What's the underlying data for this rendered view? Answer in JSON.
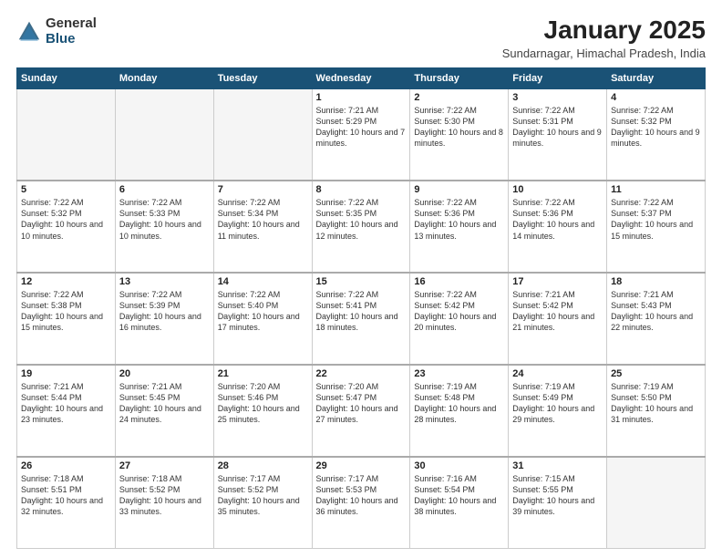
{
  "logo": {
    "general": "General",
    "blue": "Blue"
  },
  "header": {
    "month": "January 2025",
    "location": "Sundarnagar, Himachal Pradesh, India"
  },
  "weekdays": [
    "Sunday",
    "Monday",
    "Tuesday",
    "Wednesday",
    "Thursday",
    "Friday",
    "Saturday"
  ],
  "weeks": [
    [
      {
        "day": "",
        "info": ""
      },
      {
        "day": "",
        "info": ""
      },
      {
        "day": "",
        "info": ""
      },
      {
        "day": "1",
        "info": "Sunrise: 7:21 AM\nSunset: 5:29 PM\nDaylight: 10 hours\nand 7 minutes."
      },
      {
        "day": "2",
        "info": "Sunrise: 7:22 AM\nSunset: 5:30 PM\nDaylight: 10 hours\nand 8 minutes."
      },
      {
        "day": "3",
        "info": "Sunrise: 7:22 AM\nSunset: 5:31 PM\nDaylight: 10 hours\nand 9 minutes."
      },
      {
        "day": "4",
        "info": "Sunrise: 7:22 AM\nSunset: 5:32 PM\nDaylight: 10 hours\nand 9 minutes."
      }
    ],
    [
      {
        "day": "5",
        "info": "Sunrise: 7:22 AM\nSunset: 5:32 PM\nDaylight: 10 hours\nand 10 minutes."
      },
      {
        "day": "6",
        "info": "Sunrise: 7:22 AM\nSunset: 5:33 PM\nDaylight: 10 hours\nand 10 minutes."
      },
      {
        "day": "7",
        "info": "Sunrise: 7:22 AM\nSunset: 5:34 PM\nDaylight: 10 hours\nand 11 minutes."
      },
      {
        "day": "8",
        "info": "Sunrise: 7:22 AM\nSunset: 5:35 PM\nDaylight: 10 hours\nand 12 minutes."
      },
      {
        "day": "9",
        "info": "Sunrise: 7:22 AM\nSunset: 5:36 PM\nDaylight: 10 hours\nand 13 minutes."
      },
      {
        "day": "10",
        "info": "Sunrise: 7:22 AM\nSunset: 5:36 PM\nDaylight: 10 hours\nand 14 minutes."
      },
      {
        "day": "11",
        "info": "Sunrise: 7:22 AM\nSunset: 5:37 PM\nDaylight: 10 hours\nand 15 minutes."
      }
    ],
    [
      {
        "day": "12",
        "info": "Sunrise: 7:22 AM\nSunset: 5:38 PM\nDaylight: 10 hours\nand 15 minutes."
      },
      {
        "day": "13",
        "info": "Sunrise: 7:22 AM\nSunset: 5:39 PM\nDaylight: 10 hours\nand 16 minutes."
      },
      {
        "day": "14",
        "info": "Sunrise: 7:22 AM\nSunset: 5:40 PM\nDaylight: 10 hours\nand 17 minutes."
      },
      {
        "day": "15",
        "info": "Sunrise: 7:22 AM\nSunset: 5:41 PM\nDaylight: 10 hours\nand 18 minutes."
      },
      {
        "day": "16",
        "info": "Sunrise: 7:22 AM\nSunset: 5:42 PM\nDaylight: 10 hours\nand 20 minutes."
      },
      {
        "day": "17",
        "info": "Sunrise: 7:21 AM\nSunset: 5:42 PM\nDaylight: 10 hours\nand 21 minutes."
      },
      {
        "day": "18",
        "info": "Sunrise: 7:21 AM\nSunset: 5:43 PM\nDaylight: 10 hours\nand 22 minutes."
      }
    ],
    [
      {
        "day": "19",
        "info": "Sunrise: 7:21 AM\nSunset: 5:44 PM\nDaylight: 10 hours\nand 23 minutes."
      },
      {
        "day": "20",
        "info": "Sunrise: 7:21 AM\nSunset: 5:45 PM\nDaylight: 10 hours\nand 24 minutes."
      },
      {
        "day": "21",
        "info": "Sunrise: 7:20 AM\nSunset: 5:46 PM\nDaylight: 10 hours\nand 25 minutes."
      },
      {
        "day": "22",
        "info": "Sunrise: 7:20 AM\nSunset: 5:47 PM\nDaylight: 10 hours\nand 27 minutes."
      },
      {
        "day": "23",
        "info": "Sunrise: 7:19 AM\nSunset: 5:48 PM\nDaylight: 10 hours\nand 28 minutes."
      },
      {
        "day": "24",
        "info": "Sunrise: 7:19 AM\nSunset: 5:49 PM\nDaylight: 10 hours\nand 29 minutes."
      },
      {
        "day": "25",
        "info": "Sunrise: 7:19 AM\nSunset: 5:50 PM\nDaylight: 10 hours\nand 31 minutes."
      }
    ],
    [
      {
        "day": "26",
        "info": "Sunrise: 7:18 AM\nSunset: 5:51 PM\nDaylight: 10 hours\nand 32 minutes."
      },
      {
        "day": "27",
        "info": "Sunrise: 7:18 AM\nSunset: 5:52 PM\nDaylight: 10 hours\nand 33 minutes."
      },
      {
        "day": "28",
        "info": "Sunrise: 7:17 AM\nSunset: 5:52 PM\nDaylight: 10 hours\nand 35 minutes."
      },
      {
        "day": "29",
        "info": "Sunrise: 7:17 AM\nSunset: 5:53 PM\nDaylight: 10 hours\nand 36 minutes."
      },
      {
        "day": "30",
        "info": "Sunrise: 7:16 AM\nSunset: 5:54 PM\nDaylight: 10 hours\nand 38 minutes."
      },
      {
        "day": "31",
        "info": "Sunrise: 7:15 AM\nSunset: 5:55 PM\nDaylight: 10 hours\nand 39 minutes."
      },
      {
        "day": "",
        "info": ""
      }
    ]
  ]
}
